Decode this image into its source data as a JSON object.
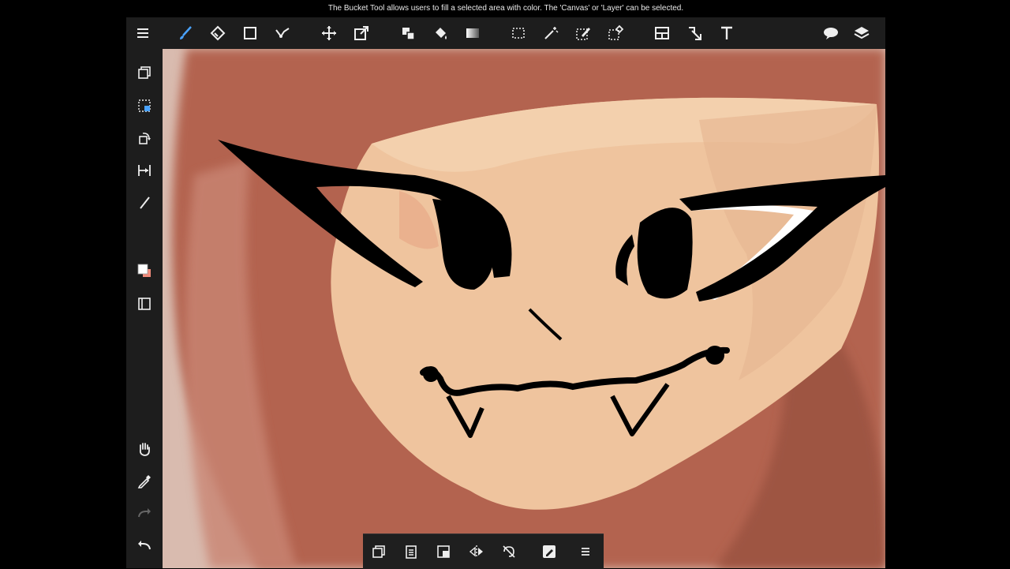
{
  "hint": {
    "text": "The Bucket Tool allows users to fill a selected area with color. The 'Canvas' or 'Layer' can be selected."
  },
  "colors": {
    "toolbar_bg": "#1d1d1d",
    "accent_blue": "#4aa3ff",
    "primary_color": "#ffffff",
    "secondary_color": "#f08a7a"
  },
  "top_toolbar": {
    "items": [
      "menu-icon",
      "brush-icon",
      "eraser-icon",
      "shape-icon",
      "select-lasso-icon",
      "move-icon",
      "transform-icon",
      "fill-color-icon",
      "bucket-icon",
      "gradient-icon",
      "selection-rect-icon",
      "magic-wand-icon",
      "selection-pen-icon",
      "selection-eraser-icon",
      "layout-icon",
      "operation-icon",
      "text-icon",
      "speech-bubble-icon",
      "layers-icon"
    ]
  },
  "left_toolbar": {
    "items": [
      "copy-icon",
      "deselect-icon",
      "rotate-icon",
      "snap-icon",
      "brush-size-icon",
      "color-swatch",
      "layer-panel-icon",
      "hand-icon",
      "eyedropper-icon",
      "redo-icon",
      "undo-icon"
    ]
  },
  "bottom_bar": {
    "items": [
      "copy-icon",
      "paste-icon",
      "clear-icon",
      "flip-icon",
      "rotate-lock-icon",
      "edit-icon",
      "menu-icon"
    ]
  }
}
